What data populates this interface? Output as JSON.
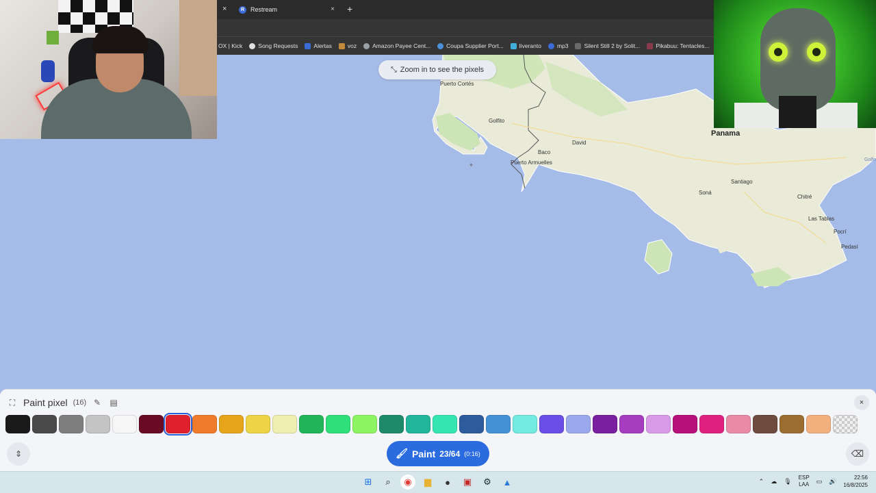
{
  "browser": {
    "tab_close_left": "×",
    "tab": {
      "favicon": "R",
      "title": "Restream",
      "close": "×"
    },
    "new_tab": "+",
    "bookmarks": [
      {
        "label": "OX | Kick",
        "icon": "kick-icon",
        "color": "#353535"
      },
      {
        "label": "Song Requests",
        "icon": "skull-icon",
        "color": "#e0e0e0"
      },
      {
        "label": "Alertas",
        "icon": "flame-icon",
        "color": "#3b6bd6"
      },
      {
        "label": "voz",
        "icon": "folder-icon",
        "color": "#c48a3c"
      },
      {
        "label": "Amazon Payee Cent...",
        "icon": "globe-icon",
        "color": "#9aa0a6"
      },
      {
        "label": "Coupa Supplier Port...",
        "icon": "dots-icon",
        "color": "#4a90d9"
      },
      {
        "label": "liveranto",
        "icon": "bird-icon",
        "color": "#3fb0d9"
      },
      {
        "label": "mp3",
        "icon": "download-icon",
        "color": "#3b6bd6"
      },
      {
        "label": "Silent Still 2 by Solit...",
        "icon": "game-icon",
        "color": "#6a6a6a"
      },
      {
        "label": "Pikabuu: Tentacles...",
        "icon": "image-icon",
        "color": "#8a3a4a"
      }
    ]
  },
  "map": {
    "zoom_hint": "Zoom in to see the pixels",
    "labels": {
      "puerto_cortes": "Puerto Cortés",
      "golfito": "Golfito",
      "panama": "Panama",
      "david": "David",
      "baco": "Baco",
      "puerto_armuelles": "Puerto Armuelles",
      "santiago": "Santiago",
      "sona": "Soná",
      "chitre": "Chitré",
      "las_tablas": "Las Tablas",
      "pocri": "Pocrí",
      "pedasi": "Pedasí",
      "golfo": "Golfo"
    }
  },
  "paint_panel": {
    "title": "Paint pixel",
    "count": "(16)",
    "close": "×",
    "paint_label": "Paint",
    "paint_progress": "23/64",
    "paint_time": "(0:16)",
    "palette": [
      "#1a1a1a",
      "#4a4a4a",
      "#7f7f7f",
      "#c4c4c4",
      "#f6f6f6",
      "#6b0a23",
      "#e0202d",
      "#f07b2a",
      "#e6a41a",
      "#ecd446",
      "#f0eeb0",
      "#23b55a",
      "#2fe07a",
      "#8ef562",
      "#1f8a6a",
      "#21b59c",
      "#35e6b3",
      "#2e5a9e",
      "#4591d8",
      "#72ebe1",
      "#6a4fe6",
      "#9aa8ec",
      "#7a1fa0",
      "#a63cbf",
      "#d99ae8",
      "#b8107a",
      "#e0207e",
      "#e88aa8",
      "#6e4b3e",
      "#9b6d30",
      "#f2b07f",
      "transparent"
    ],
    "selected_index": 6
  },
  "taskbar": {
    "lang_top": "ESP",
    "lang_bottom": "LAA",
    "time": "22:56",
    "date": "16/8/2025"
  }
}
